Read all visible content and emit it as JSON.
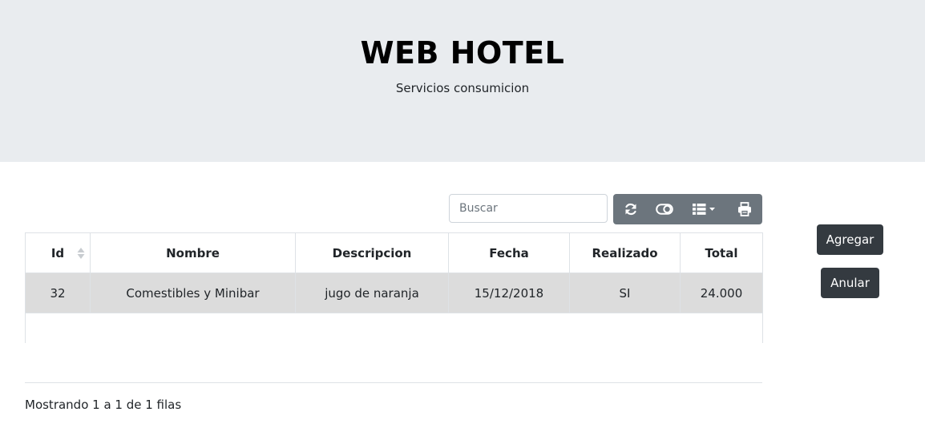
{
  "header": {
    "title": "WEB HOTEL",
    "subtitle": "Servicios consumicion"
  },
  "toolbar": {
    "search_placeholder": "Buscar",
    "buttons": [
      "refresh-icon",
      "toggle-icon",
      "columns-icon",
      "print-icon"
    ],
    "color": "#6c757d"
  },
  "table": {
    "columns": [
      "Id",
      "Nombre",
      "Descripcion",
      "Fecha",
      "Realizado",
      "Total"
    ],
    "rows": [
      {
        "id": "32",
        "nombre": "Comestibles y Minibar",
        "descripcion": "jugo de naranja",
        "fecha": "15/12/2018",
        "realizado": "SI",
        "total": "24.000"
      }
    ]
  },
  "pagination": {
    "info": "Mostrando 1 a 1 de 1 filas"
  },
  "actions": {
    "agregar": "Agregar",
    "anular": "Anular",
    "color": "#343a40"
  }
}
